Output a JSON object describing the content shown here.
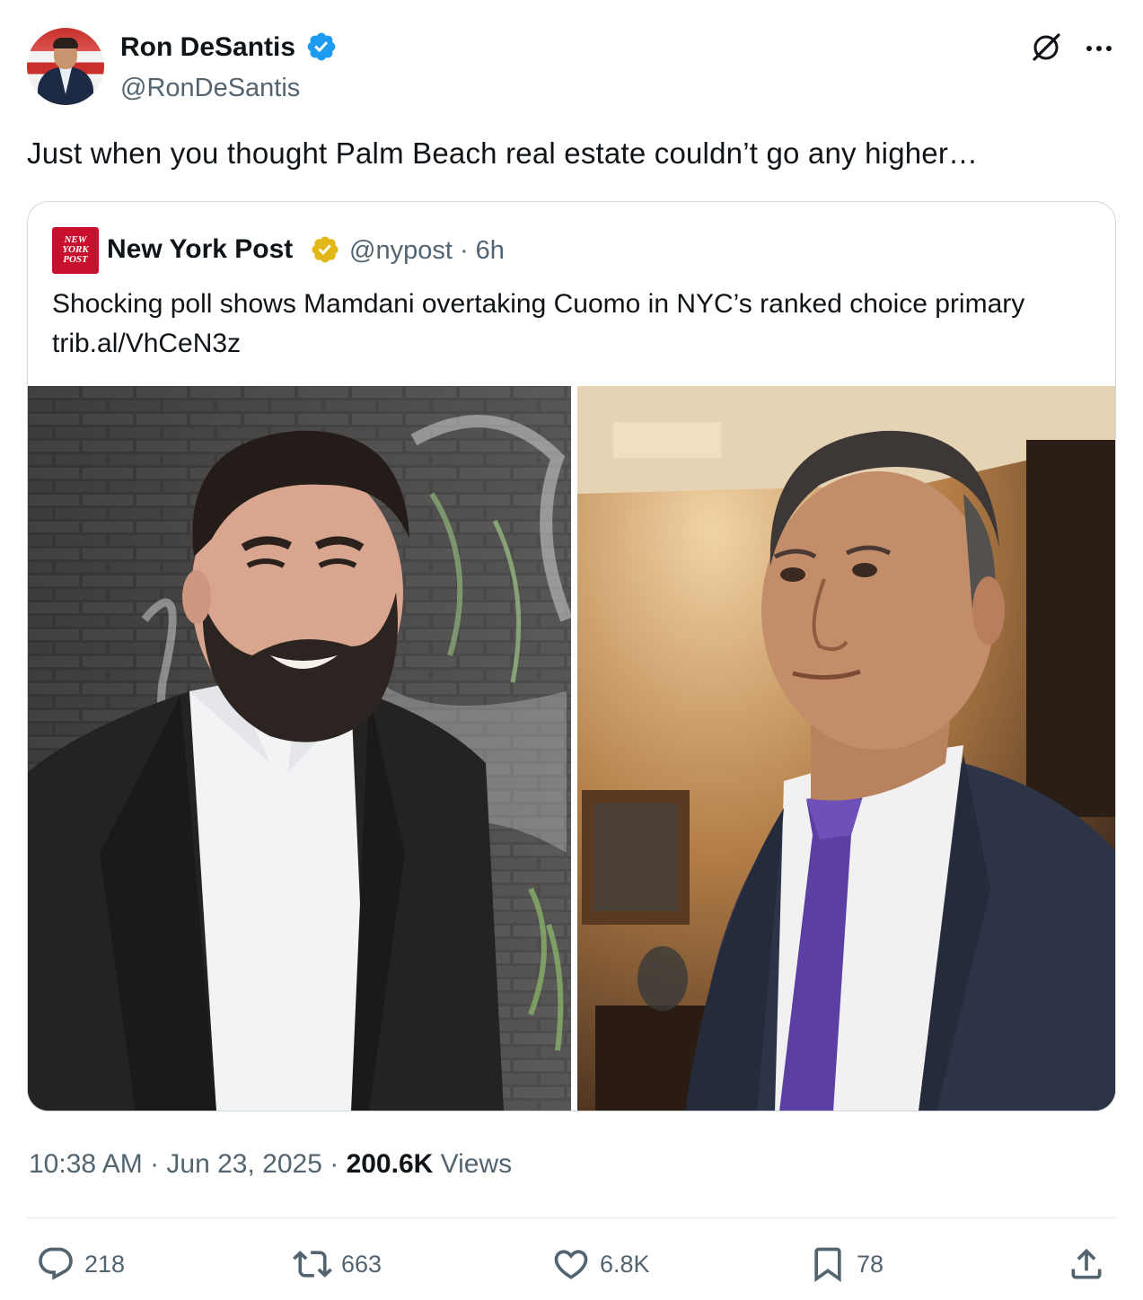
{
  "author": {
    "name": "Ron DeSantis",
    "handle": "@RonDeSantis",
    "verified": true,
    "verified_color": "#1d9bf0"
  },
  "tweet_text": "Just when you thought Palm Beach real estate couldn’t go any higher…",
  "quoted_tweet": {
    "logo_text": [
      "NEW",
      "YORK",
      "POST"
    ],
    "name": "New York Post",
    "badge_color": "#e2b719",
    "meta": "@nypost · 6h",
    "text": "Shocking poll shows Mamdani overtaking Cuomo in NYC’s ranked choice primary",
    "link": "trib.al/VhCeN3z",
    "images": [
      "photo-smiling-man-brick-wall",
      "photo-older-man-purple-tie"
    ]
  },
  "timestamp": {
    "time_date": "10:38 AM · Jun 23, 2025 · ",
    "views_count": "200.6K",
    "views_label": " Views"
  },
  "actions": {
    "replies": "218",
    "reposts": "663",
    "likes": "6.8K",
    "bookmarks": "78"
  },
  "icons": [
    "grok-icon",
    "more-icon",
    "reply-icon",
    "repost-icon",
    "like-icon",
    "bookmark-icon",
    "share-icon"
  ]
}
